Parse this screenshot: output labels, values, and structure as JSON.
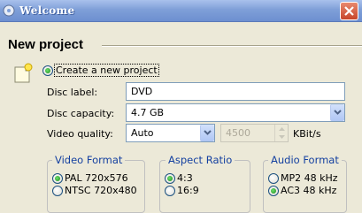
{
  "window": {
    "title": "Welcome"
  },
  "header": {
    "title": "New project"
  },
  "create_option": {
    "label": "Create a new project",
    "selected": true
  },
  "disc_label": {
    "label": "Disc label:",
    "value": "DVD"
  },
  "disc_capacity": {
    "label": "Disc capacity:",
    "value": "4.7 GB"
  },
  "video_quality": {
    "label": "Video quality:",
    "value": "Auto",
    "bitrate": "4500",
    "unit": "KBit/s"
  },
  "video_format": {
    "title": "Video Format",
    "options": [
      "PAL 720x576",
      "NTSC 720x480"
    ],
    "selected": "PAL 720x576"
  },
  "aspect_ratio": {
    "title": "Aspect Ratio",
    "options": [
      "4:3",
      "16:9"
    ],
    "selected": "4:3"
  },
  "audio_format": {
    "title": "Audio Format",
    "options": [
      "MP2 48 kHz",
      "AC3 48 kHz"
    ],
    "selected": "AC3 48 kHz"
  }
}
